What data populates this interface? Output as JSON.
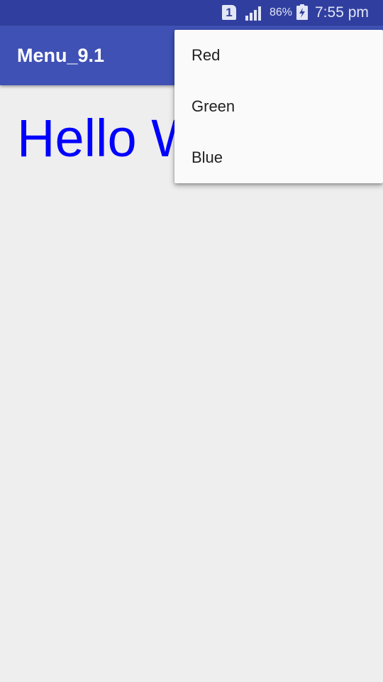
{
  "status_bar": {
    "sim_label": "1",
    "battery_percent": "86%",
    "time": "7:55 pm",
    "icons": [
      "sim-icon",
      "signal-icon",
      "battery-charging-icon"
    ]
  },
  "app_bar": {
    "title": "Menu_9.1",
    "color": "#3f51b5"
  },
  "content": {
    "text": "Hello World!",
    "text_color": "#0000ff"
  },
  "menu": {
    "items": [
      {
        "label": "Red"
      },
      {
        "label": "Green"
      },
      {
        "label": "Blue"
      }
    ]
  }
}
